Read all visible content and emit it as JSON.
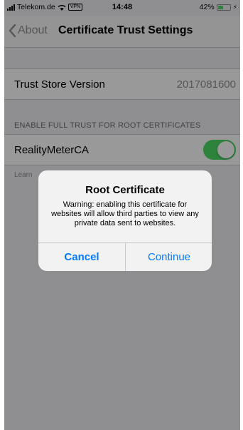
{
  "status_bar": {
    "carrier": "Telekom.de",
    "vpn": "VPN",
    "time": "14:48",
    "battery_percent": "42%",
    "battery_level": 0.42
  },
  "nav": {
    "back_label": "About",
    "title": "Certificate Trust Settings"
  },
  "trust_store": {
    "label": "Trust Store Version",
    "value": "2017081600"
  },
  "full_trust": {
    "header": "ENABLE FULL TRUST FOR ROOT CERTIFICATES",
    "cert_name": "RealityMeterCA",
    "enabled": true
  },
  "footer": {
    "learn_partial": "Learn"
  },
  "alert": {
    "title": "Root Certificate",
    "message": "Warning: enabling this certificate for websites will allow third parties to view any private data sent to websites.",
    "cancel_label": "Cancel",
    "continue_label": "Continue"
  },
  "colors": {
    "accent": "#007aff",
    "toggle_on": "#4cd964",
    "background": "#efeff4"
  }
}
